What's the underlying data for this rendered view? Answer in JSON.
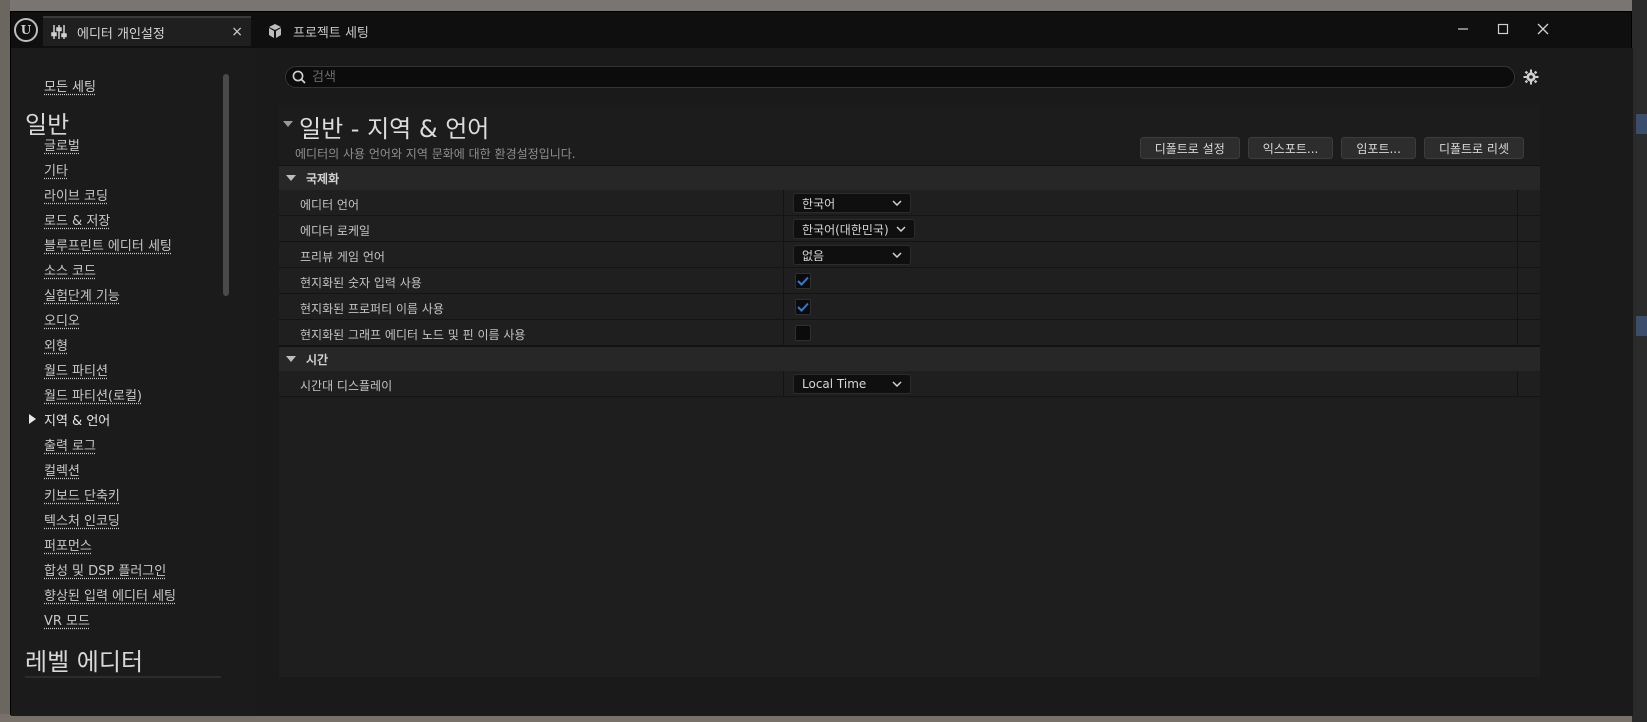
{
  "window": {
    "tabs": [
      {
        "label": "에디터 개인설정",
        "active": true
      },
      {
        "label": "프로젝트 세팅",
        "active": false
      }
    ],
    "controls": {
      "minimize": "—",
      "maximize": "□",
      "close": "✕"
    }
  },
  "sidebar": {
    "all_settings": "모든 세팅",
    "section_general": "일반",
    "section_level_editor": "레벨 에디터",
    "items": [
      {
        "label": "글로벌"
      },
      {
        "label": "기타"
      },
      {
        "label": "라이브 코딩"
      },
      {
        "label": "로드 & 저장"
      },
      {
        "label": "블루프린트 에디터 세팅"
      },
      {
        "label": "소스 코드"
      },
      {
        "label": "실험단계 기능"
      },
      {
        "label": "오디오"
      },
      {
        "label": "외형"
      },
      {
        "label": "월드 파티션"
      },
      {
        "label": "월드 파티션(로컬)"
      },
      {
        "label": "지역 & 언어",
        "selected": true
      },
      {
        "label": "출력 로그"
      },
      {
        "label": "컬렉션"
      },
      {
        "label": "키보드 단축키"
      },
      {
        "label": "텍스처 인코딩"
      },
      {
        "label": "퍼포먼스"
      },
      {
        "label": "합성 및 DSP 플러그인"
      },
      {
        "label": "향상된 입력 에디터 세팅"
      },
      {
        "label": "VR 모드"
      }
    ]
  },
  "search": {
    "placeholder": "검색",
    "value": ""
  },
  "panel": {
    "title": "일반 - 지역 & 언어",
    "description": "에디터의 사용 언어와 지역 문화에 대한 환경설정입니다.",
    "buttons": {
      "set_default": "디폴트로 설정",
      "export": "익스포트...",
      "import": "임포트...",
      "reset_default": "디폴트로 리셋"
    },
    "categories": {
      "internationalization": {
        "label": "국제화",
        "rows": {
          "editor_language": {
            "label": "에디터 언어",
            "value": "한국어"
          },
          "editor_locale": {
            "label": "에디터 로케일",
            "value": "한국어(대한민국)"
          },
          "preview_game_language": {
            "label": "프리뷰 게임 언어",
            "value": "없음"
          },
          "localized_numeric_input": {
            "label": "현지화된 숫자 입력 사용",
            "checked": true
          },
          "localized_property_names": {
            "label": "현지화된 프로퍼티 이름 사용",
            "checked": true
          },
          "localized_graph_names": {
            "label": "현지화된 그래프 에디터 노드 및 핀 이름 사용",
            "checked": false
          }
        }
      },
      "time": {
        "label": "시간",
        "rows": {
          "timezone_display": {
            "label": "시간대 디스플레이",
            "value": "Local Time"
          }
        }
      }
    }
  },
  "colors": {
    "accent_check": "#2e7bd8",
    "background": "#151515",
    "panel": "#1e1e1e"
  }
}
